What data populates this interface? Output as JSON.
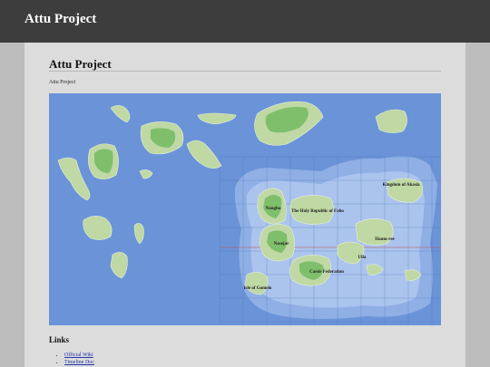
{
  "navbar": {
    "brand": "Attu Project"
  },
  "main": {
    "title": "Attu Project",
    "subtitle": "Attu Project",
    "map": {
      "ocean_color": "#6a93d8",
      "land_color": "#bfd8a4",
      "forest_color": "#7fbf6c",
      "shallow_color": "#9cb8ea",
      "labels": {
        "kingdom_of_akasia": "Kingdom of Akasia",
        "naugha": "Naugha",
        "holy_republic": "The Holy Republic of Faho",
        "hauto_ree": "Hauto-ree",
        "nasejar": "Nasejar",
        "ulla": "Ulla",
        "cassis_federation": "Cassis Federation",
        "isle_of_gomelo": "Isle of Gomelo"
      }
    },
    "links_heading": "Links",
    "links": [
      {
        "label": "Official Wiki"
      },
      {
        "label": "Timeline Doc"
      }
    ]
  }
}
